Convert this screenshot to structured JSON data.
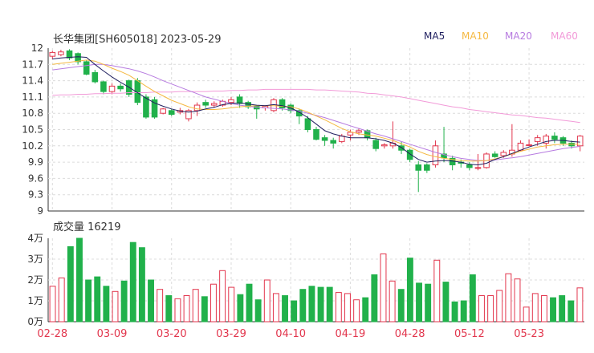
{
  "header": {
    "title": "长华集团[SH605018] 2023-05-29",
    "ma_labels": [
      {
        "label": "MA5",
        "color": "#1f1f5f"
      },
      {
        "label": "MA10",
        "color": "#f5b942"
      },
      {
        "label": "MA20",
        "color": "#b77be0"
      },
      {
        "label": "MA60",
        "color": "#f29ad8"
      }
    ],
    "volume_title": "成交量 16219"
  },
  "colors": {
    "up": "#e2364d",
    "down": "#21b14b",
    "axis": "#333333",
    "grid": "#dcdcdc"
  },
  "chart_data": [
    {
      "type": "candlestick",
      "title": "长华集团[SH605018] 2023-05-29",
      "y_ticks": [
        "12",
        "11.7",
        "11.4",
        "11.1",
        "10.8",
        "10.5",
        "10.2",
        "9.9",
        "9.6",
        "9.3",
        "9"
      ],
      "ylim": [
        9,
        12
      ],
      "x_tick_labels": [
        "02-28",
        "03-09",
        "03-20",
        "03-29",
        "04-10",
        "04-19",
        "04-28",
        "05-12",
        "05-23"
      ],
      "x_tick_indices": [
        0,
        7,
        14,
        21,
        28,
        35,
        42,
        49,
        56
      ],
      "candles": [
        [
          11.85,
          11.92,
          11.8,
          11.95
        ],
        [
          11.88,
          11.93,
          11.85,
          11.97
        ],
        [
          11.95,
          11.82,
          11.78,
          11.98
        ],
        [
          11.9,
          11.75,
          11.7,
          11.92
        ],
        [
          11.75,
          11.52,
          11.5,
          11.78
        ],
        [
          11.55,
          11.38,
          11.35,
          11.6
        ],
        [
          11.38,
          11.2,
          11.15,
          11.4
        ],
        [
          11.2,
          11.3,
          11.15,
          11.35
        ],
        [
          11.3,
          11.25,
          11.2,
          11.35
        ],
        [
          11.4,
          11.15,
          11.1,
          11.42
        ],
        [
          11.4,
          11.0,
          10.95,
          11.45
        ],
        [
          11.1,
          10.73,
          10.7,
          11.15
        ],
        [
          11.05,
          10.73,
          10.7,
          11.1
        ],
        [
          10.8,
          10.88,
          10.78,
          10.9
        ],
        [
          10.85,
          10.78,
          10.75,
          10.88
        ],
        [
          10.82,
          10.85,
          10.78,
          10.9
        ],
        [
          10.7,
          10.85,
          10.65,
          10.88
        ],
        [
          10.85,
          10.95,
          10.75,
          11.0
        ],
        [
          11.0,
          10.95,
          10.9,
          11.05
        ],
        [
          10.95,
          10.98,
          10.9,
          11.02
        ],
        [
          10.95,
          11.02,
          10.92,
          11.05
        ],
        [
          11.0,
          11.05,
          10.95,
          11.1
        ],
        [
          11.1,
          10.98,
          10.9,
          11.15
        ],
        [
          11.0,
          10.92,
          10.88,
          11.03
        ],
        [
          10.93,
          10.88,
          10.7,
          10.95
        ],
        [
          10.9,
          10.93,
          10.85,
          10.95
        ],
        [
          10.85,
          11.05,
          10.82,
          11.08
        ],
        [
          11.05,
          10.9,
          10.85,
          11.08
        ],
        [
          10.95,
          10.85,
          10.8,
          10.98
        ],
        [
          10.85,
          10.75,
          10.6,
          10.88
        ],
        [
          10.7,
          10.5,
          10.45,
          10.75
        ],
        [
          10.5,
          10.32,
          10.3,
          10.55
        ],
        [
          10.35,
          10.3,
          10.2,
          10.4
        ],
        [
          10.3,
          10.25,
          10.15,
          10.35
        ],
        [
          10.28,
          10.38,
          10.25,
          10.42
        ],
        [
          10.4,
          10.45,
          10.3,
          10.5
        ],
        [
          10.45,
          10.48,
          10.4,
          10.52
        ],
        [
          10.48,
          10.35,
          10.3,
          10.5
        ],
        [
          10.3,
          10.15,
          10.1,
          10.35
        ],
        [
          10.2,
          10.22,
          10.15,
          10.25
        ],
        [
          10.2,
          10.25,
          10.15,
          10.65
        ],
        [
          10.2,
          10.12,
          10.05,
          10.28
        ],
        [
          10.12,
          9.95,
          9.9,
          10.15
        ],
        [
          9.85,
          9.75,
          9.35,
          9.92
        ],
        [
          9.85,
          9.75,
          9.7,
          9.88
        ],
        [
          9.85,
          10.2,
          9.8,
          10.3
        ],
        [
          10.05,
          9.98,
          9.9,
          10.55
        ],
        [
          9.97,
          9.85,
          9.75,
          10.02
        ],
        [
          9.9,
          9.88,
          9.8,
          9.95
        ],
        [
          9.85,
          9.8,
          9.75,
          9.9
        ],
        [
          9.8,
          9.8,
          9.75,
          10.05
        ],
        [
          9.8,
          10.05,
          9.78,
          10.08
        ],
        [
          10.05,
          10.0,
          9.98,
          10.1
        ],
        [
          10.02,
          10.08,
          9.98,
          10.12
        ],
        [
          10.05,
          10.12,
          10.0,
          10.6
        ],
        [
          10.12,
          10.25,
          10.1,
          10.3
        ],
        [
          10.22,
          10.22,
          10.2,
          10.32
        ],
        [
          10.28,
          10.35,
          10.2,
          10.4
        ],
        [
          10.25,
          10.38,
          10.15,
          10.42
        ],
        [
          10.38,
          10.32,
          10.25,
          10.45
        ],
        [
          10.35,
          10.25,
          10.2,
          10.38
        ],
        [
          10.25,
          10.2,
          10.15,
          10.3
        ],
        [
          10.2,
          10.38,
          10.1,
          10.4
        ]
      ],
      "ma5": [
        11.8,
        11.82,
        11.83,
        11.84,
        11.83,
        11.7,
        11.58,
        11.47,
        11.37,
        11.28,
        11.18,
        11.08,
        10.99,
        10.93,
        10.88,
        10.84,
        10.82,
        10.84,
        10.88,
        10.91,
        10.96,
        10.98,
        10.99,
        10.97,
        10.95,
        10.94,
        10.96,
        10.94,
        10.9,
        10.82,
        10.72,
        10.6,
        10.48,
        10.42,
        10.38,
        10.35,
        10.35,
        10.35,
        10.33,
        10.3,
        10.25,
        10.17,
        10.05,
        9.95,
        9.9,
        9.92,
        9.93,
        9.92,
        9.9,
        9.86,
        9.85,
        9.88,
        9.95,
        10.0,
        10.06,
        10.12,
        10.18,
        10.23,
        10.28,
        10.3,
        10.3,
        10.28,
        10.27
      ],
      "ma10": [
        11.7,
        11.72,
        11.74,
        11.76,
        11.78,
        11.76,
        11.7,
        11.63,
        11.57,
        11.5,
        11.4,
        11.3,
        11.2,
        11.12,
        11.04,
        10.98,
        10.92,
        10.88,
        10.87,
        10.87,
        10.88,
        10.9,
        10.92,
        10.93,
        10.94,
        10.94,
        10.94,
        10.93,
        10.92,
        10.88,
        10.82,
        10.75,
        10.68,
        10.6,
        10.52,
        10.46,
        10.42,
        10.4,
        10.38,
        10.34,
        10.3,
        10.24,
        10.18,
        10.1,
        10.04,
        10.0,
        9.97,
        9.95,
        9.93,
        9.92,
        9.92,
        9.93,
        9.96,
        10.0,
        10.05,
        10.1,
        10.14,
        10.18,
        10.2,
        10.22,
        10.23,
        10.23,
        10.23
      ],
      "ma20": [
        11.6,
        11.62,
        11.64,
        11.66,
        11.68,
        11.7,
        11.7,
        11.68,
        11.65,
        11.62,
        11.58,
        11.53,
        11.47,
        11.4,
        11.34,
        11.28,
        11.22,
        11.16,
        11.1,
        11.06,
        11.02,
        10.98,
        10.95,
        10.93,
        10.91,
        10.9,
        10.89,
        10.88,
        10.86,
        10.84,
        10.8,
        10.76,
        10.72,
        10.67,
        10.62,
        10.57,
        10.52,
        10.47,
        10.42,
        10.38,
        10.33,
        10.28,
        10.23,
        10.18,
        10.13,
        10.08,
        10.04,
        10.0,
        9.97,
        9.95,
        9.93,
        9.93,
        9.94,
        9.96,
        9.98,
        10.0,
        10.03,
        10.06,
        10.09,
        10.12,
        10.15,
        10.17,
        10.19
      ],
      "ma60": [
        11.13,
        11.14,
        11.14,
        11.15,
        11.15,
        11.16,
        11.16,
        11.17,
        11.17,
        11.18,
        11.18,
        11.18,
        11.19,
        11.19,
        11.19,
        11.2,
        11.2,
        11.2,
        11.2,
        11.21,
        11.21,
        11.22,
        11.22,
        11.23,
        11.23,
        11.24,
        11.24,
        11.24,
        11.24,
        11.24,
        11.24,
        11.23,
        11.23,
        11.22,
        11.21,
        11.2,
        11.19,
        11.17,
        11.16,
        11.14,
        11.12,
        11.1,
        11.07,
        11.04,
        11.01,
        10.98,
        10.95,
        10.92,
        10.9,
        10.87,
        10.85,
        10.83,
        10.81,
        10.79,
        10.77,
        10.76,
        10.74,
        10.72,
        10.71,
        10.69,
        10.67,
        10.65,
        10.63
      ]
    },
    {
      "type": "bar",
      "title": "成交量 16219",
      "y_ticks": [
        "4万",
        "3万",
        "2万",
        "1万",
        "0万"
      ],
      "ylim": [
        0,
        40000
      ],
      "values": [
        17000,
        21000,
        36000,
        40000,
        20000,
        21500,
        17000,
        14500,
        19500,
        38000,
        35500,
        20000,
        15500,
        12500,
        11000,
        12500,
        15500,
        12000,
        18000,
        24500,
        16500,
        13000,
        18000,
        10500,
        20000,
        13500,
        12500,
        10000,
        15500,
        17000,
        16500,
        16500,
        14000,
        13500,
        10500,
        11500,
        22500,
        32500,
        19500,
        15500,
        30500,
        18500,
        18000,
        29500,
        19000,
        9500,
        10000,
        22500,
        12500,
        12500,
        15000,
        23000,
        20500,
        7000,
        13500,
        12500,
        11500,
        12500,
        10000,
        16219
      ]
    }
  ]
}
